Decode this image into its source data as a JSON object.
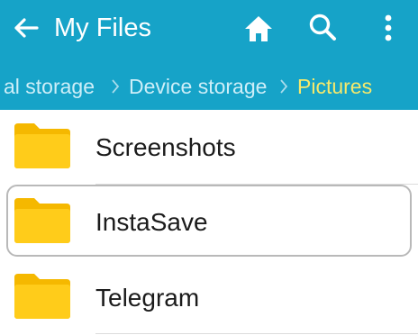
{
  "app": {
    "title": "My Files",
    "accent_color": "#16a3c8",
    "breadcrumb_current_color": "#f6e96b"
  },
  "toolbar": {
    "back_icon": "arrow-left-icon",
    "home_icon": "home-icon",
    "search_icon": "search-icon",
    "more_icon": "more-vertical-icon"
  },
  "breadcrumb": [
    {
      "label": "al storage"
    },
    {
      "label": "Device storage"
    },
    {
      "label": "Pictures",
      "current": true
    }
  ],
  "files": [
    {
      "name": "Screenshots",
      "type": "folder",
      "icon": "folder-icon"
    },
    {
      "name": "InstaSave",
      "type": "folder",
      "icon": "folder-icon",
      "selected": true
    },
    {
      "name": "Telegram",
      "type": "folder",
      "icon": "folder-icon"
    }
  ]
}
